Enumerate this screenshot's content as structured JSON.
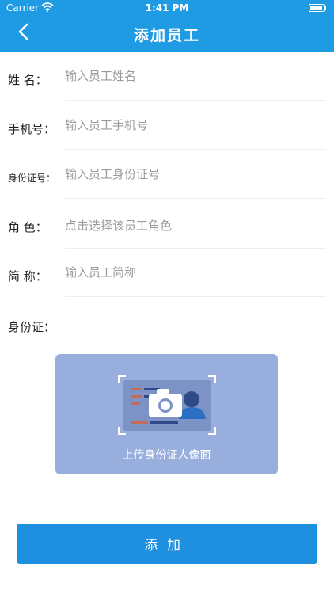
{
  "status_bar": {
    "carrier": "Carrier",
    "time": "1:41 PM"
  },
  "header": {
    "title": "添加员工",
    "back_icon": "chevron-left-icon"
  },
  "form": {
    "name": {
      "label": "姓 名：",
      "placeholder": "输入员工姓名"
    },
    "phone": {
      "label": "手机号：",
      "placeholder": "输入员工手机号"
    },
    "id_number": {
      "label": "身份证号：",
      "placeholder": "输入员工身份证号"
    },
    "role": {
      "label": "角 色：",
      "placeholder": "点击选择该员工角色"
    },
    "nickname": {
      "label": "简 称：",
      "placeholder": "输入员工简称"
    }
  },
  "id_card": {
    "label": "身份证：",
    "upload_caption": "上传身份证人像面",
    "icon": "camera-icon"
  },
  "submit": {
    "label": "添加"
  },
  "colors": {
    "primary": "#1f9be3",
    "button": "#1f8fe0",
    "upload_bg": "#98afde"
  }
}
